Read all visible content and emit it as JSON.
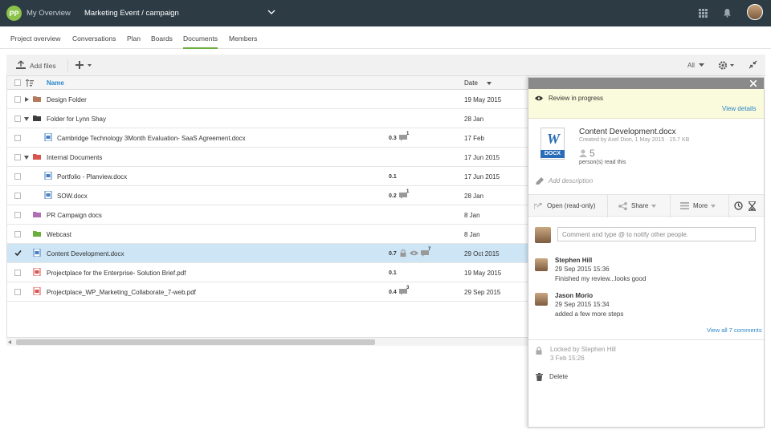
{
  "topbar": {
    "logo": "PP",
    "my_overview": "My Overview",
    "project_title": "Marketing Event / campaign"
  },
  "nav": {
    "tabs": [
      "Project overview",
      "Conversations",
      "Plan",
      "Boards",
      "Documents",
      "Members"
    ],
    "active": "Documents"
  },
  "toolbar": {
    "add_files": "Add files",
    "filter": "All"
  },
  "list": {
    "col_name": "Name",
    "col_date": "Date",
    "rows": [
      {
        "name": "Design Folder",
        "date": "19 May 2015",
        "ver": "",
        "comments": ""
      },
      {
        "name": "Folder for Lynn Shay",
        "date": "28 Jan",
        "ver": "",
        "comments": ""
      },
      {
        "name": "Cambridge Technology 3Month Evaluation- SaaS Agreement.docx",
        "date": "17 Feb",
        "ver": "0.3",
        "comments": "1"
      },
      {
        "name": "Internal Documents",
        "date": "17 Jun 2015",
        "ver": "",
        "comments": ""
      },
      {
        "name": "Portfolio - Planview.docx",
        "date": "17 Jun 2015",
        "ver": "0.1",
        "comments": ""
      },
      {
        "name": "SOW.docx",
        "date": "28 Jan",
        "ver": "0.2",
        "comments": "1"
      },
      {
        "name": "PR Campaign docs",
        "date": "8 Jan",
        "ver": "",
        "comments": ""
      },
      {
        "name": "Webcast",
        "date": "8 Jan",
        "ver": "",
        "comments": ""
      },
      {
        "name": "Content Development.docx",
        "date": "29 Oct 2015",
        "ver": "0.7",
        "comments": "7"
      },
      {
        "name": "Projectplace for the Enterprise- Solution Brief.pdf",
        "date": "19 May 2015",
        "ver": "0.1",
        "comments": ""
      },
      {
        "name": "Projectplace_WP_Marketing_Collaborate_7-web.pdf",
        "date": "29 Sep 2015",
        "ver": "0.4",
        "comments": "3"
      }
    ]
  },
  "panel": {
    "status": "Review in progress",
    "view_details": "View details",
    "file_badge": "DOCX",
    "file_name": "Content Development.docx",
    "file_meta": "Created by Axel Dion, 1 May 2015  ·  15.7 KB",
    "read_count": "5",
    "read_label": "person(s) read this",
    "add_description": "Add description",
    "open_label": "Open (read-only)",
    "share_label": "Share",
    "more_label": "More",
    "comment_placeholder": "Comment and type @ to notify other people.",
    "comments": [
      {
        "author": "Stephen Hill",
        "date": "29 Sep 2015 15:36",
        "text": "Finished my review...looks good"
      },
      {
        "author": "Jason Morio",
        "date": "29 Sep 2015 15:34",
        "text": "added a few more steps"
      }
    ],
    "view_all": "View all 7 comments",
    "locked_by": "Locked by Stephen Hill",
    "locked_date": "3 Feb 15:26",
    "delete_label": "Delete"
  }
}
